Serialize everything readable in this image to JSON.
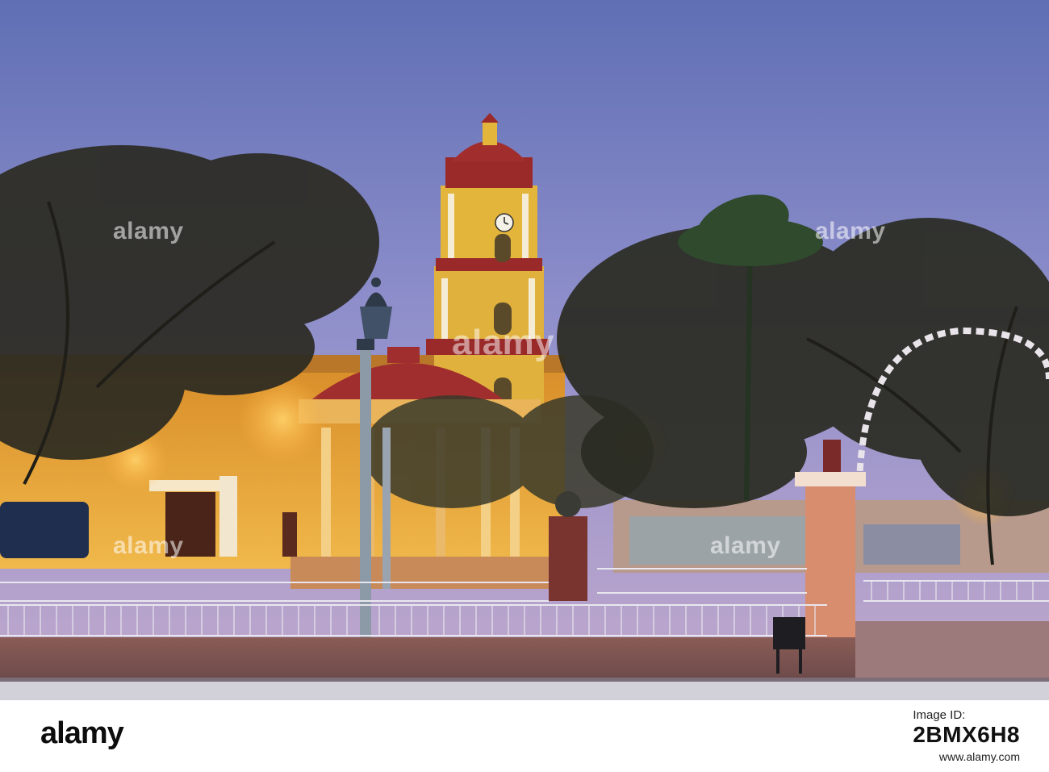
{
  "photo": {
    "subject": "Church bell tower and bandstand in town square at dusk",
    "watermark_text": "alamy"
  },
  "footer": {
    "logo_text": "alamy",
    "image_id_label": "Image ID:",
    "image_id_value": "2BMX6H8",
    "url": "www.alamy.com"
  },
  "colors": {
    "sky_top": "#6a78b8",
    "sky_bottom": "#b8a8cf",
    "facade": "#e8a93a",
    "tower_yellow": "#e3b53a",
    "tower_red": "#9a2a2a",
    "foliage": "#2a2a1e"
  }
}
